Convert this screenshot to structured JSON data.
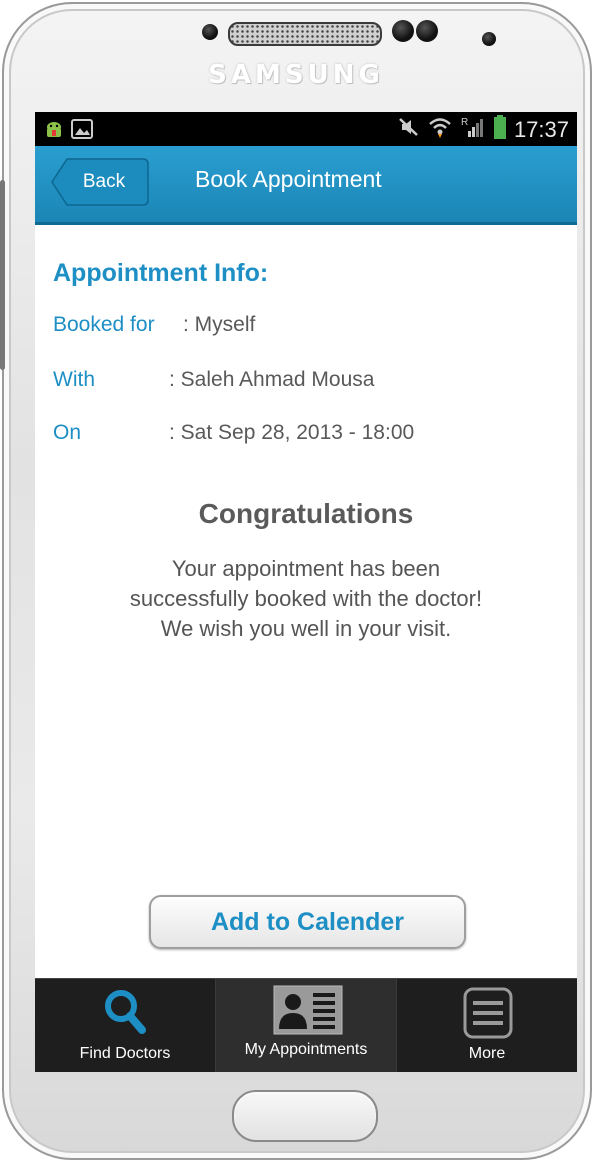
{
  "device": {
    "brand": "SAMSUNG"
  },
  "statusbar": {
    "time": "17:37"
  },
  "titlebar": {
    "back_label": "Back",
    "title": "Book Appointment"
  },
  "appointment": {
    "heading": "Appointment Info:",
    "rows": [
      {
        "label": "Booked for",
        "value": ": Myself"
      },
      {
        "label": "With",
        "value": ": Saleh Ahmad Mousa"
      },
      {
        "label": "On",
        "value": ": Sat Sep 28, 2013 - 18:00"
      }
    ]
  },
  "confirmation": {
    "title": "Congratulations",
    "lines": [
      "Your appointment has been",
      "successfully booked with the doctor!",
      "We wish you well in your visit."
    ]
  },
  "actions": {
    "add_to_calendar": "Add to Calender"
  },
  "tabs": [
    {
      "label": "Find Doctors",
      "icon": "search-icon"
    },
    {
      "label": "My Appointments",
      "icon": "contact-card-icon"
    },
    {
      "label": "More",
      "icon": "menu-icon"
    }
  ],
  "colors": {
    "accent": "#1d8fc5",
    "titlebar": "#2a9ed0",
    "tabbar": "#1e1e1e"
  }
}
